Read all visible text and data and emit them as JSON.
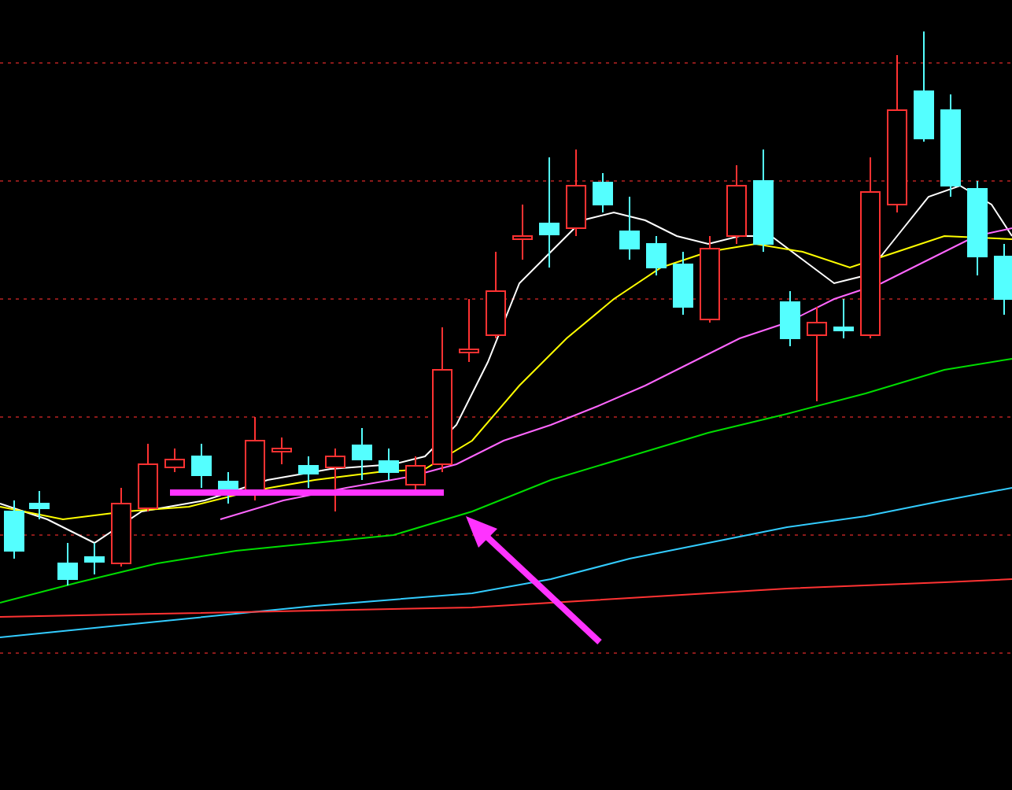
{
  "moving_averages": [
    {
      "color": "#ffffff"
    },
    {
      "color": "#ffff00"
    },
    {
      "color": "#ff66ff"
    },
    {
      "color": "#00dd00"
    },
    {
      "color": "#33ccff"
    },
    {
      "color": "#ff3333"
    }
  ]
}
